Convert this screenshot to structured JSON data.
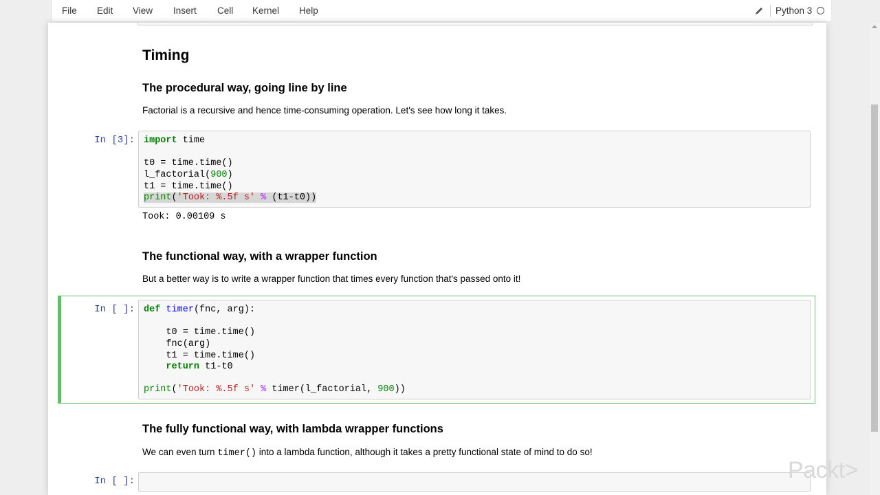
{
  "menu": {
    "items": [
      "File",
      "Edit",
      "View",
      "Insert",
      "Cell",
      "Kernel",
      "Help"
    ],
    "kernel_name": "Python 3",
    "edit_icon": "pencil-icon",
    "kernel_status_icon": "kernel-idle-circle-icon"
  },
  "notebook": {
    "heading_timing": "Timing",
    "heading_procedural": "The procedural way, going line by line",
    "para_procedural": "Factorial is a recursive and hence time-consuming operation. Let's see how long it takes.",
    "cell1": {
      "prompt": "In [3]:",
      "output": "Took: 0.00109 s"
    },
    "heading_functional": "The functional way, with a wrapper function",
    "para_functional": "But a better way is to write a wrapper function that times every function that's passed onto it!",
    "cell2": {
      "prompt": "In [ ]:"
    },
    "heading_lambda": "The fully functional way, with lambda wrapper functions",
    "para_lambda_pre": "We can even turn ",
    "para_lambda_code": "timer()",
    "para_lambda_post": " into a lambda function, although it takes a pretty functional state of mind to do so!",
    "cell3": {
      "prompt": "In [ ]:"
    }
  },
  "code": {
    "c1_l1_kw": "import",
    "c1_l1_rest": " time",
    "c1_l3": "t0 = time.time()",
    "c1_l4_a": "l_factorial(",
    "c1_l4_num": "900",
    "c1_l4_b": ")",
    "c1_l5": "t1 = time.time()",
    "c1_l6_a": "print",
    "c1_l6_b": "(",
    "c1_l6_str": "'Took: %.5f s'",
    "c1_l6_op": " % ",
    "c1_l6_c": "(t1-t0))",
    "c2_l1_kw": "def",
    "c2_l1_fn": "timer",
    "c2_l1_rest": "(fnc, arg):",
    "c2_l3": "    t0 = time.time()",
    "c2_l4": "    fnc(arg)",
    "c2_l5": "    t1 = time.time()",
    "c2_l6_indent": "    ",
    "c2_l6_kw": "return",
    "c2_l6_rest": " t1-t0",
    "c2_l8_a": "print",
    "c2_l8_b": "(",
    "c2_l8_str": "'Took: %.5f s'",
    "c2_l8_op": " % ",
    "c2_l8_c": "timer(l_factorial, ",
    "c2_l8_num": "900",
    "c2_l8_d": "))"
  },
  "watermark": "Packt>"
}
